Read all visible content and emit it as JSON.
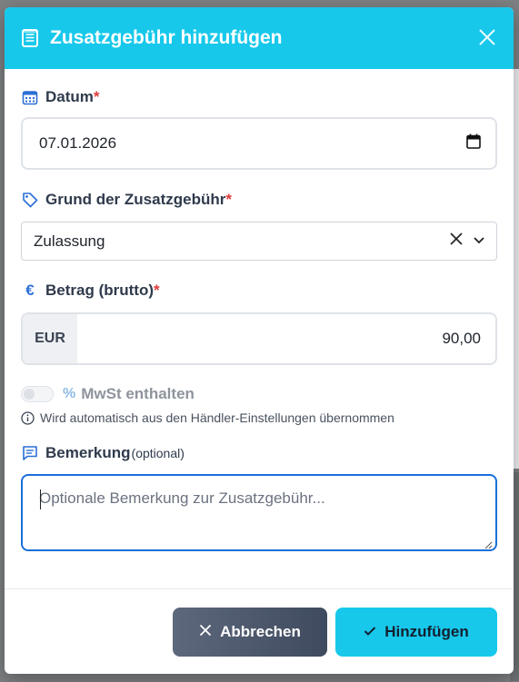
{
  "modal": {
    "title": "Zusatzgebühr hinzufügen",
    "title_icon": "receipt-icon",
    "close_icon": "close-icon"
  },
  "fields": {
    "date": {
      "label": "Datum",
      "required_mark": "*",
      "value": "07.01.2026",
      "icon": "calendar-icon"
    },
    "reason": {
      "label": "Grund der Zusatzgebühr",
      "required_mark": "*",
      "value": "Zulassung",
      "icon": "tag-icon"
    },
    "amount": {
      "label": "Betrag (brutto)",
      "required_mark": "*",
      "currency": "EUR",
      "value": "90,00",
      "icon": "euro-icon",
      "icon_glyph": "€"
    },
    "vat": {
      "label": "MwSt enthalten",
      "symbol": "%",
      "enabled": false,
      "hint": "Wird automatisch aus den Händler-Einstellungen übernommen"
    },
    "note": {
      "label": "Bemerkung",
      "optional_label": "(optional)",
      "placeholder": "Optionale Bemerkung zur Zusatzgebühr...",
      "value": "",
      "icon": "comment-icon"
    }
  },
  "footer": {
    "cancel_label": "Abbrechen",
    "add_label": "Hinzufügen"
  },
  "colors": {
    "header": "#17c8eb",
    "required": "#e03b3b",
    "focus_border": "#1a6fd9",
    "cancel_bg": "#4b5568"
  }
}
